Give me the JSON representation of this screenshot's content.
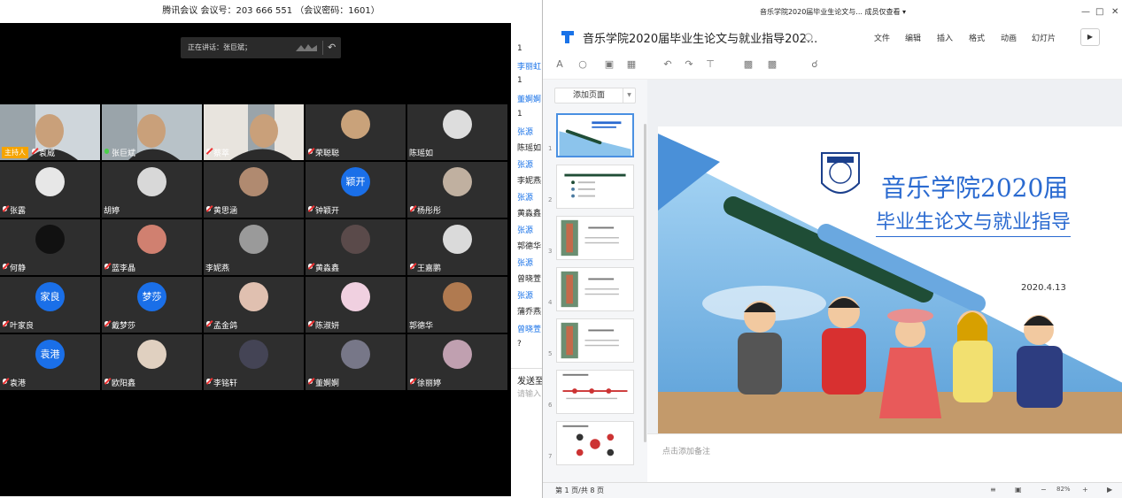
{
  "meeting": {
    "title": "腾讯会议 会议号：203 666 551 （会议密码：1601）",
    "speaking": "正在讲话：张巨斌；",
    "host_badge": "主持人",
    "participants": [
      {
        "name": "袁威",
        "host": true,
        "mic": "muted",
        "video": true
      },
      {
        "name": "张巨斌",
        "mic": "on",
        "video": true
      },
      {
        "name": "蔡萃",
        "mic": "muted",
        "video": true
      },
      {
        "name": "荣聪聪",
        "mic": "muted"
      },
      {
        "name": "陈瑶如"
      },
      {
        "name": "张露",
        "mic": "muted"
      },
      {
        "name": "胡婷"
      },
      {
        "name": "黄思涵",
        "mic": "muted"
      },
      {
        "name": "钟颖开",
        "mic": "muted",
        "avatar_text": "颖开"
      },
      {
        "name": "杨彤彤",
        "mic": "muted"
      },
      {
        "name": "何静",
        "mic": "muted"
      },
      {
        "name": "蓝李晶",
        "mic": "muted"
      },
      {
        "name": "李妮燕"
      },
      {
        "name": "黄淼鑫",
        "mic": "muted"
      },
      {
        "name": "王嘉鹏",
        "mic": "muted"
      },
      {
        "name": "叶家良",
        "mic": "muted",
        "avatar_text": "家良"
      },
      {
        "name": "戴梦莎",
        "mic": "muted",
        "avatar_text": "梦莎"
      },
      {
        "name": "孟金鸽",
        "mic": "muted"
      },
      {
        "name": "陈淑妍",
        "mic": "muted"
      },
      {
        "name": "郭德华"
      },
      {
        "name": "袁港",
        "mic": "muted",
        "avatar_text": "袁港"
      },
      {
        "name": "欧阳鑫",
        "mic": "muted"
      },
      {
        "name": "李铭轩",
        "mic": "muted"
      },
      {
        "name": "董婀婀",
        "mic": "muted"
      },
      {
        "name": "徐丽婷",
        "mic": "muted"
      }
    ]
  },
  "chat": {
    "items": [
      {
        "t": "1",
        "k": "c"
      },
      {
        "t": "李丽虹",
        "k": "n"
      },
      {
        "t": "1",
        "k": "c"
      },
      {
        "t": "董婀婀",
        "k": "n"
      },
      {
        "t": "1",
        "k": "c"
      },
      {
        "t": "张源",
        "k": "n"
      },
      {
        "t": "陈瑶如",
        "k": "c"
      },
      {
        "t": "张源",
        "k": "n"
      },
      {
        "t": "李妮燕",
        "k": "c"
      },
      {
        "t": "张源",
        "k": "n"
      },
      {
        "t": "黄淼鑫",
        "k": "c"
      },
      {
        "t": "张源",
        "k": "n"
      },
      {
        "t": "郭德华",
        "k": "c"
      },
      {
        "t": "张源",
        "k": "n"
      },
      {
        "t": "曾晓萱",
        "k": "c"
      },
      {
        "t": "张源",
        "k": "n"
      },
      {
        "t": "蒲乔燕",
        "k": "c"
      },
      {
        "t": "曾晓萱",
        "k": "n"
      },
      {
        "t": "?",
        "k": "c"
      }
    ],
    "send_label": "发送至",
    "input_placeholder": "请输入"
  },
  "pp": {
    "window_title": "音乐学院2020届毕业生论文与... 成员仅查看 ▾",
    "doc_title": "音乐学院2020届毕业生论文与就业指导202...",
    "menu": [
      "文件",
      "编辑",
      "插入",
      "格式",
      "动画",
      "幻灯片"
    ],
    "add_page": "添加页面",
    "thumb_numbers": [
      "1",
      "2",
      "3",
      "4",
      "5",
      "6",
      "7"
    ],
    "slide": {
      "title1": "音乐学院2020届",
      "title2": "毕业生论文与就业指导",
      "date": "2020.4.13"
    },
    "notes_placeholder": "点击添加备注",
    "status": {
      "page": "第 1 页/共 8 页",
      "zoom": "82%"
    },
    "colors": {
      "accent": "#2a6ad0",
      "dark_green": "#1f4d36"
    }
  }
}
